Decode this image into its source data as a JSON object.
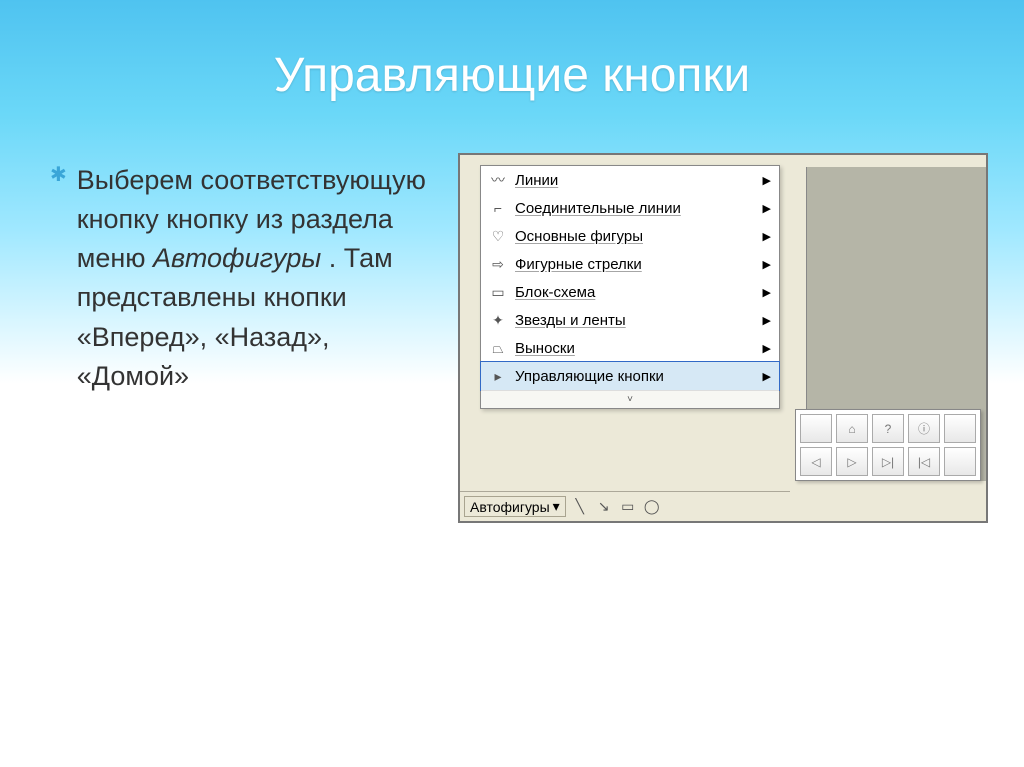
{
  "slide": {
    "title": "Управляющие кнопки",
    "bullet": {
      "part1": "Выберем соответствующую кнопку кнопку из раздела меню ",
      "italic": "Автофигуры",
      "part2": " . Там представлены кнопки «Вперед», «Назад», «Домой»"
    }
  },
  "menu": {
    "items": [
      {
        "label": "Линии",
        "icon": "lines-icon"
      },
      {
        "label": "Соединительные линии",
        "icon": "connectors-icon"
      },
      {
        "label": "Основные фигуры",
        "icon": "basic-shapes-icon"
      },
      {
        "label": "Фигурные стрелки",
        "icon": "block-arrows-icon"
      },
      {
        "label": "Блок-схема",
        "icon": "flowchart-icon"
      },
      {
        "label": "Звезды и ленты",
        "icon": "stars-icon"
      },
      {
        "label": "Выноски",
        "icon": "callouts-icon"
      },
      {
        "label": "Управляющие кнопки",
        "icon": "action-buttons-icon",
        "selected": true
      }
    ],
    "chevrons": "˅"
  },
  "toolbar": {
    "autoshapes_label": "Автофигуры",
    "dropdown_arrow": "▾"
  },
  "action_buttons": {
    "row1": [
      "",
      "⌂",
      "?",
      "ⓘ",
      ""
    ],
    "row2": [
      "◁",
      "▷",
      "▷|",
      "|◁",
      ""
    ]
  },
  "icons": {
    "lines-icon": "〰",
    "connectors-icon": "⌐",
    "basic-shapes-icon": "♡",
    "block-arrows-icon": "⇨",
    "flowchart-icon": "▭",
    "stars-icon": "✦",
    "callouts-icon": "⏢",
    "action-buttons-icon": "▸"
  }
}
